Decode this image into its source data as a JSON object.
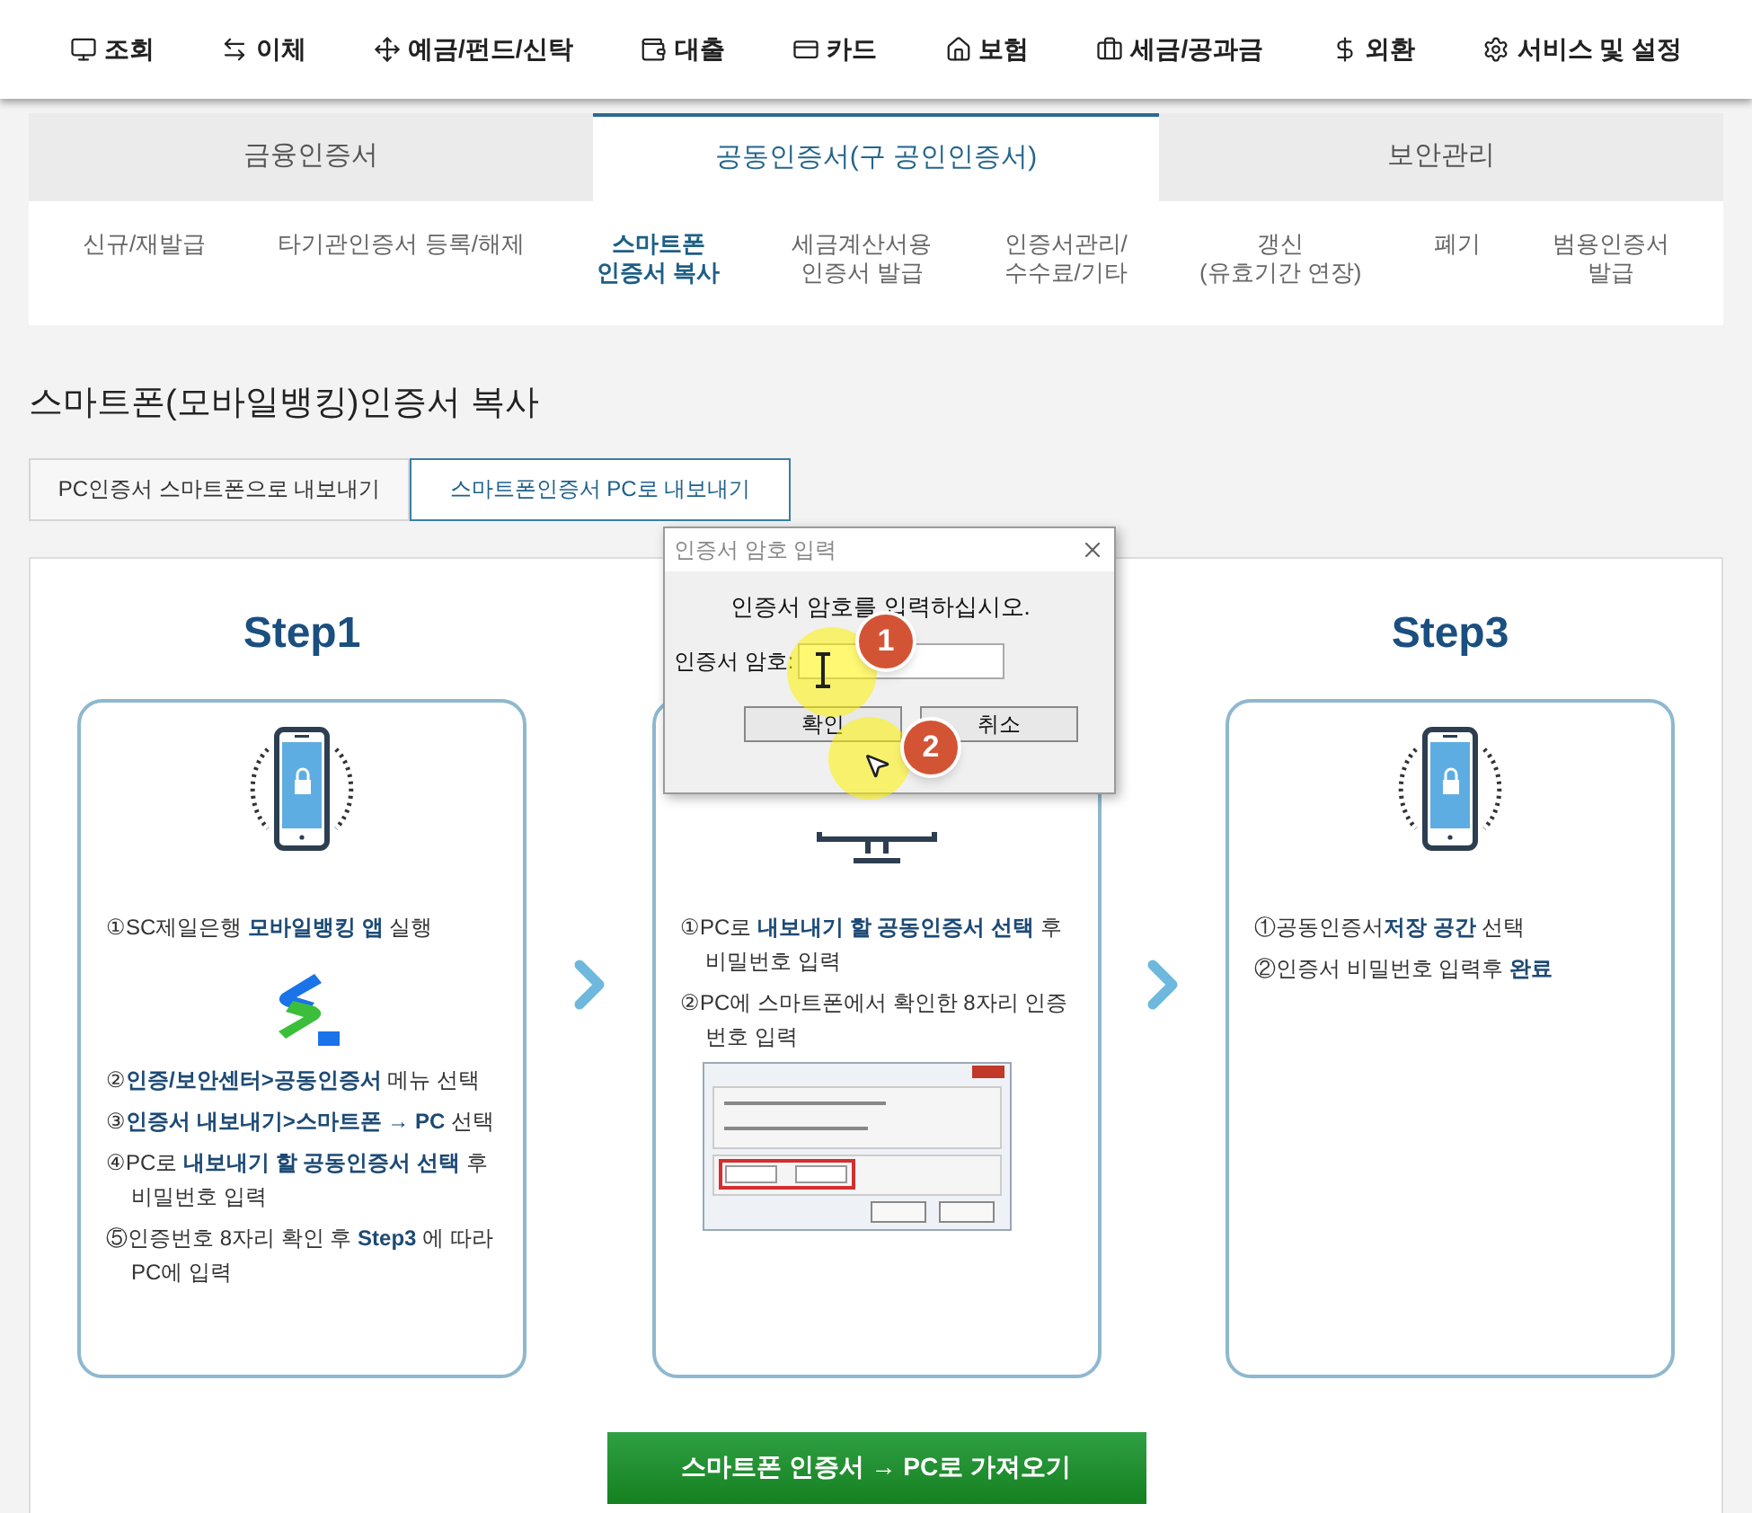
{
  "nav": [
    {
      "kind": "lookup",
      "label": "조회"
    },
    {
      "kind": "transfer",
      "label": "이체"
    },
    {
      "kind": "deposit",
      "label": "예금/펀드/신탁"
    },
    {
      "kind": "loan",
      "label": "대출"
    },
    {
      "kind": "card",
      "label": "카드"
    },
    {
      "kind": "insurance",
      "label": "보험"
    },
    {
      "kind": "tax",
      "label": "세금/공과금"
    },
    {
      "kind": "forex",
      "label": "외환"
    },
    {
      "kind": "settings",
      "label": "서비스 및 설정"
    }
  ],
  "tabs": [
    {
      "label": "금융인증서",
      "selected": false
    },
    {
      "label": "공동인증서(구 공인인증서)",
      "selected": true
    },
    {
      "label": "보안관리",
      "selected": false
    }
  ],
  "subtabs": [
    {
      "label": "신규/재발급",
      "selected": false
    },
    {
      "label": "타기관인증서 등록/해제",
      "selected": false
    },
    {
      "label": "스마트폰\n인증서 복사",
      "selected": true
    },
    {
      "label": "세금계산서용\n인증서 발급",
      "selected": false
    },
    {
      "label": "인증서관리/\n수수료/기타",
      "selected": false
    },
    {
      "label": "갱신\n(유효기간 연장)",
      "selected": false
    },
    {
      "label": "폐기",
      "selected": false
    },
    {
      "label": "범용인증서\n발급",
      "selected": false
    }
  ],
  "page_title": "스마트폰(모바일뱅킹)인증서 복사",
  "segments": [
    {
      "label": "PC인증서 스마트폰으로 내보내기",
      "selected": false
    },
    {
      "label": "스마트폰인증서 PC로 내보내기",
      "selected": true
    }
  ],
  "steps": [
    {
      "title": "Step1",
      "kind": "app",
      "items": [
        "①SC제일은행 **모바일뱅킹 앱** 실행",
        "②**인증/보안센터>공동인증서** 메뉴 선택",
        "③**인증서 내보내기>스마트폰 → PC** 선택",
        "④PC로 **내보내기 할 공동인증서 선택** 후 비밀번호 입력",
        "⑤인증번호 8자리 확인 후 **Step3** 에 따라 PC에 입력"
      ]
    },
    {
      "kind": "pc",
      "items": [
        "①PC로 **내보내기 할 공동인증서 선택** 후 비밀번호 입력",
        "②PC에 스마트폰에서 확인한 8자리 인증번호 입력"
      ]
    },
    {
      "title": "Step3",
      "kind": "phone",
      "items": [
        "①공동인증서**저장 공간** 선택",
        "②인증서 비밀번호 입력후 **완료**"
      ]
    }
  ],
  "action_button": "스마트폰 인증서 → PC로 가져오기",
  "dialog": {
    "title": "인증서 암호 입력",
    "message": "인증서 암호를 입력하십시오.",
    "field_label": "인증서 암호:",
    "buttons": [
      "확인",
      "취소"
    ],
    "markers": [
      "1",
      "2"
    ]
  }
}
